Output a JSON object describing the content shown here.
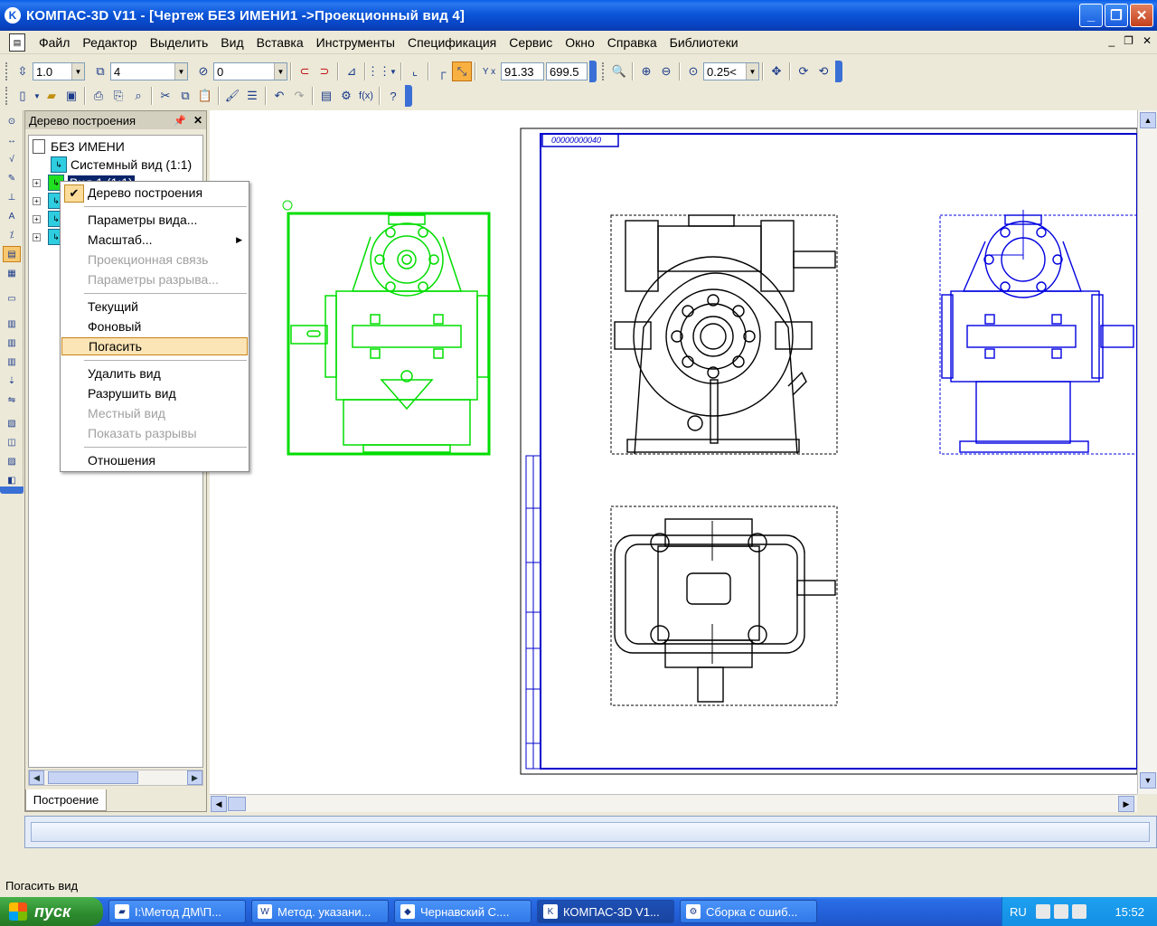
{
  "window": {
    "title": "КОМПАС-3D V11 - [Чертеж БЕЗ ИМЕНИ1 ->Проекционный вид 4]"
  },
  "menu": [
    "Файл",
    "Редактор",
    "Выделить",
    "Вид",
    "Вставка",
    "Инструменты",
    "Спецификация",
    "Сервис",
    "Окно",
    "Справка",
    "Библиотеки"
  ],
  "toolbar1": {
    "step": "1.0",
    "layer": "4",
    "style": "0",
    "coord_x": "91.33",
    "coord_y": "699.5",
    "zoom": "0.25<"
  },
  "tree": {
    "title": "Дерево построения",
    "root": "БЕЗ ИМЕНИ",
    "items": [
      "Системный вид (1:1)",
      "Вид 1 (1:1)"
    ],
    "tab": "Построение"
  },
  "context_menu": {
    "items": [
      {
        "label": "Дерево построения"
      },
      {
        "label": "Параметры вида..."
      },
      {
        "label": "Масштаб..."
      },
      {
        "label": "Проекционная связь"
      },
      {
        "label": "Параметры разрыва..."
      },
      {
        "label": "Текущий"
      },
      {
        "label": "Фоновый"
      },
      {
        "label": "Погасить"
      },
      {
        "label": "Удалить вид"
      },
      {
        "label": "Разрушить вид"
      },
      {
        "label": "Местный вид"
      },
      {
        "label": "Показать разрывы"
      },
      {
        "label": "Отношения"
      }
    ]
  },
  "drawing": {
    "stamp_text": "00000000040"
  },
  "status": {
    "text": "Погасить вид"
  },
  "taskbar": {
    "start": "пуск",
    "tasks": [
      "I:\\Метод ДМ\\П...",
      "Метод. указани...",
      "Чернавский С....",
      "КОМПАС-3D V1...",
      "Сборка с ошиб..."
    ],
    "lang": "RU",
    "clock": "15:52"
  },
  "colors": {
    "green_view": "#00dd00",
    "blue_view": "#0000e0",
    "frame_blue": "#0000cc"
  }
}
